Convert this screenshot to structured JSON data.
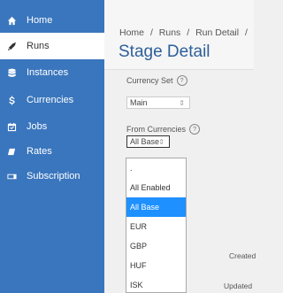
{
  "sidebar": {
    "items": [
      {
        "label": "Home",
        "icon": "home-icon"
      },
      {
        "label": "Runs",
        "icon": "rocket-icon"
      },
      {
        "label": "Instances",
        "icon": "database-icon"
      },
      {
        "label": "Currencies",
        "icon": "dollar-icon"
      },
      {
        "label": "Jobs",
        "icon": "calendar-check-icon"
      },
      {
        "label": "Rates",
        "icon": "tag-icon"
      },
      {
        "label": "Subscription",
        "icon": "card-icon"
      }
    ],
    "active": "Runs"
  },
  "breadcrumb": {
    "items": [
      "Home",
      "Runs",
      "Run Detail",
      ""
    ],
    "separator": "/"
  },
  "page_title": "Stage Detail",
  "currency_set": {
    "label": "Currency Set",
    "value": "Main"
  },
  "from_currencies": {
    "label": "From Currencies",
    "value": "All Base",
    "options": [
      ".",
      "All Enabled",
      "All Base",
      "EUR",
      "GBP",
      "HUF",
      "ISK"
    ],
    "selected": "All Base"
  },
  "meta_labels": {
    "created": "Created",
    "updated": "Updated"
  },
  "colors": {
    "sidebar": "#3a76bd",
    "title": "#2d5f99",
    "selected": "#1e90ff"
  }
}
